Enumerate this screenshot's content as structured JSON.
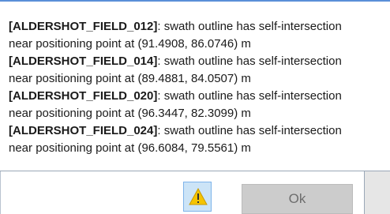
{
  "message": {
    "entries": [
      {
        "field": "[ALDERSHOT_FIELD_012]",
        "text": ": swath outline has self-intersection",
        "detail": "near positioning point at (91.4908, 86.0746) m"
      },
      {
        "field": "[ALDERSHOT_FIELD_014]",
        "text": ": swath outline has self-intersection",
        "detail": "near positioning point at (89.4881, 84.0507) m"
      },
      {
        "field": "[ALDERSHOT_FIELD_020]",
        "text": ": swath outline has self-intersection",
        "detail": "near positioning point at (96.3447, 82.3099) m"
      },
      {
        "field": "[ALDERSHOT_FIELD_024]",
        "text": ": swath outline has self-intersection",
        "detail": "near positioning point at (96.6084, 79.5561) m"
      }
    ]
  },
  "buttons": {
    "warning_icon": "warning-triangle-icon",
    "ok_label": "Ok"
  },
  "colors": {
    "warning_fill": "#f5c400",
    "warning_button_bg": "#cce4f7",
    "ok_button_bg": "#cccccc",
    "accent_border": "#5a8fd8"
  }
}
